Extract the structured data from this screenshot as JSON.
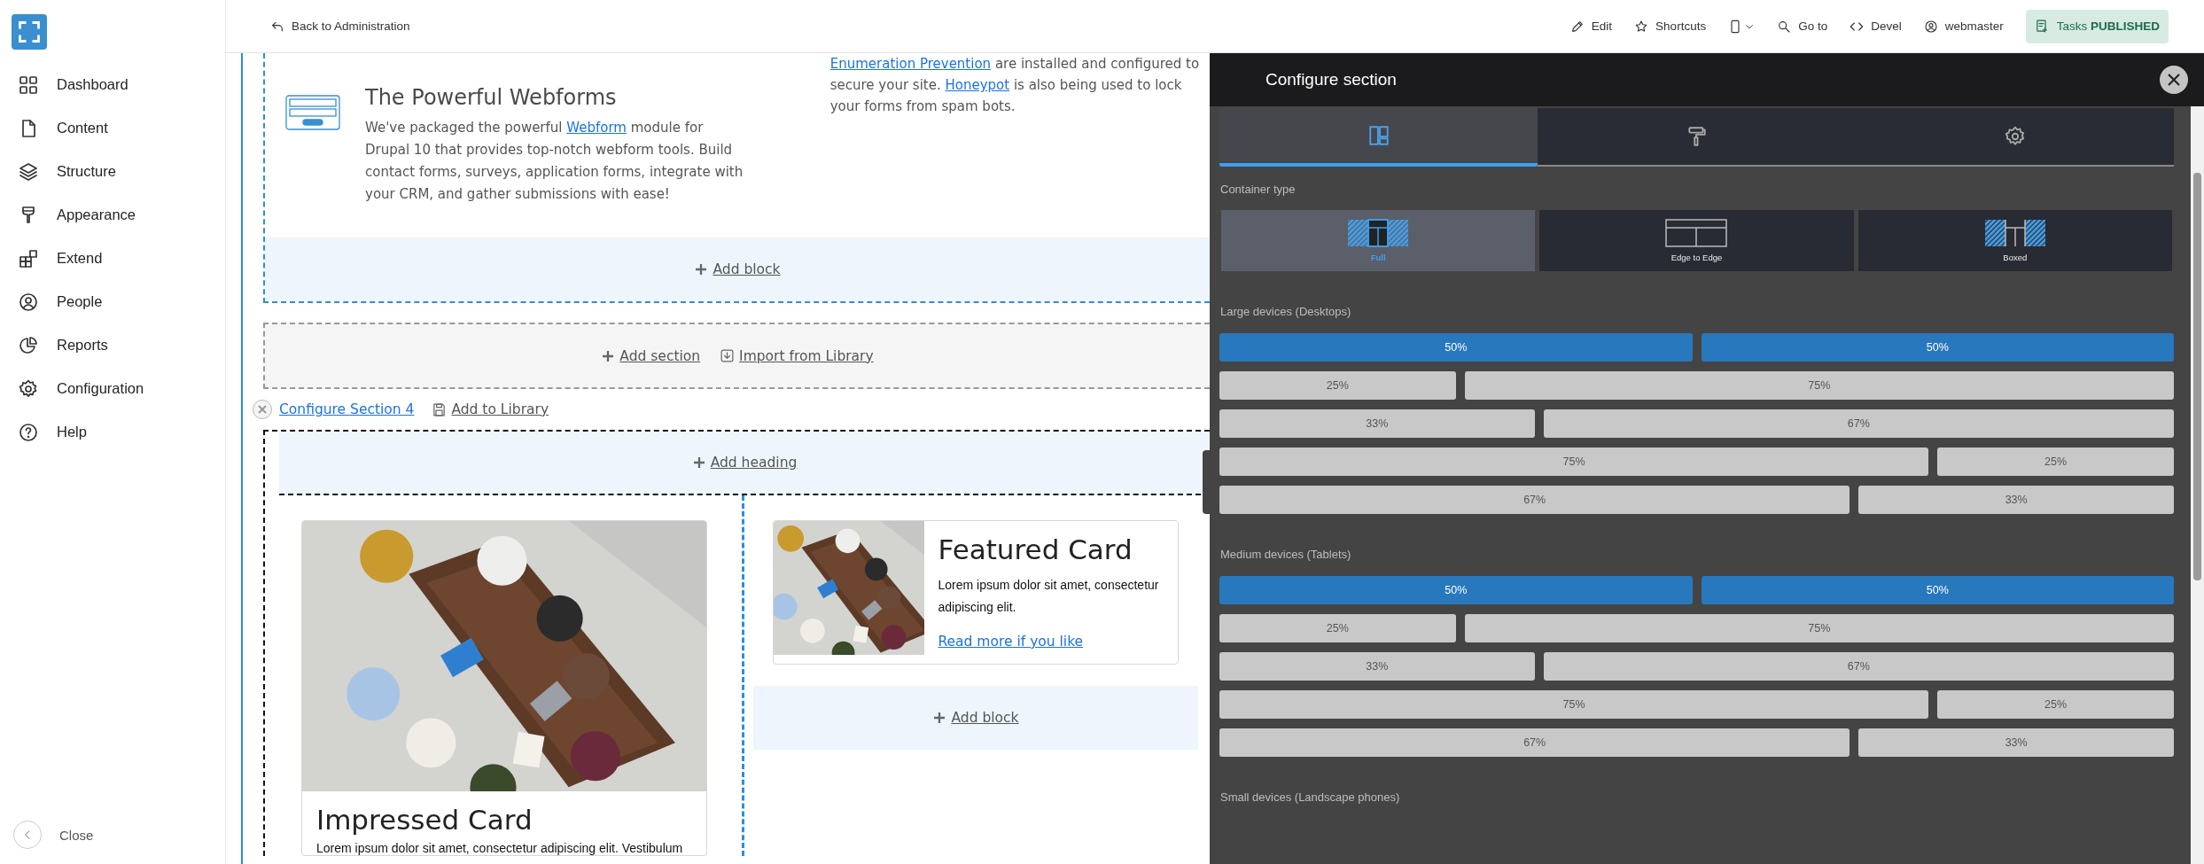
{
  "sidebar": {
    "items": [
      {
        "label": "Dashboard"
      },
      {
        "label": "Content"
      },
      {
        "label": "Structure"
      },
      {
        "label": "Appearance"
      },
      {
        "label": "Extend"
      },
      {
        "label": "People"
      },
      {
        "label": "Reports"
      },
      {
        "label": "Configuration"
      },
      {
        "label": "Help"
      }
    ],
    "close": "Close"
  },
  "topbar": {
    "back": "Back to Administration",
    "actions": [
      {
        "kind": "link",
        "label": "Edit"
      },
      {
        "kind": "link",
        "label": "Shortcuts"
      },
      {
        "kind": "device"
      },
      {
        "kind": "link",
        "label": "Go to"
      },
      {
        "kind": "link",
        "label": "Devel"
      },
      {
        "kind": "link",
        "label": "webmaster"
      }
    ],
    "tasks": "Tasks **PUBLISHED**"
  },
  "webforms": {
    "title": "The Powerful Webforms",
    "paragraph": [
      {
        "kind": "text",
        "text": "We've packaged the powerful "
      },
      {
        "kind": "link",
        "text": "Webform"
      },
      {
        "kind": "text",
        "text": " module for Drupal 10 that provides top-notch webform tools. Build contact forms, surveys, application forms, integrate with your CRM, and gather submissions with ease!"
      }
    ],
    "aside": [
      {
        "kind": "link",
        "text": "Enumeration Prevention"
      },
      {
        "kind": "text",
        "text": " are installed and configured to secure your site. "
      },
      {
        "kind": "link",
        "text": "Honeypot"
      },
      {
        "kind": "text",
        "text": " is also being used to lock your forms from spam bots."
      }
    ],
    "add_block": "Add block"
  },
  "add_section": {
    "add": "Add section",
    "import": "Import from Library"
  },
  "section_toolbar": {
    "configure": "Configure Section 4",
    "library": "Add to Library"
  },
  "section": {
    "add_heading": "Add heading",
    "impressed_card": {
      "title": "Impressed Card",
      "text": "Lorem ipsum dolor sit amet, consectetur adipiscing elit. Vestibulum"
    },
    "featured_card": {
      "title": "Featured Card",
      "text": "Lorem ipsum dolor sit amet, consectetur adipiscing elit.",
      "link": "Read more if you like"
    },
    "add_block": "Add block"
  },
  "panel": {
    "title": "Configure section",
    "tabs": [
      {
        "selected": true
      },
      {
        "selected": false
      },
      {
        "selected": false
      }
    ],
    "container_label": "Container type",
    "container_options": [
      {
        "label": "Full",
        "selected": true
      },
      {
        "label": "Edge to Edge",
        "selected": false
      },
      {
        "label": "Boxed",
        "selected": false
      }
    ],
    "layouts": [
      {
        "label": "Large devices (Desktops)",
        "rows": [
          {
            "kind": "halves",
            "selected": true,
            "options": [
              "50%",
              "50%"
            ]
          },
          {
            "kind": "quarterleft",
            "selected": false,
            "options": [
              "25%",
              "75%"
            ]
          },
          {
            "kind": "thirdleft",
            "selected": false,
            "options": [
              "33%",
              "67%"
            ]
          },
          {
            "kind": "quarterright",
            "selected": false,
            "options": [
              "75%",
              "25%"
            ]
          },
          {
            "kind": "thirdright",
            "selected": false,
            "options": [
              "67%",
              "33%"
            ]
          }
        ]
      },
      {
        "label": "Medium devices (Tablets)",
        "rows": [
          {
            "kind": "halves",
            "selected": true,
            "options": [
              "50%",
              "50%"
            ]
          },
          {
            "kind": "quarterleft",
            "selected": false,
            "options": [
              "25%",
              "75%"
            ]
          },
          {
            "kind": "thirdleft",
            "selected": false,
            "options": [
              "33%",
              "67%"
            ]
          },
          {
            "kind": "quarterright",
            "selected": false,
            "options": [
              "75%",
              "25%"
            ]
          },
          {
            "kind": "thirdright",
            "selected": false,
            "options": [
              "67%",
              "33%"
            ]
          }
        ]
      },
      {
        "label": "Small devices (Landscape phones)"
      }
    ]
  }
}
